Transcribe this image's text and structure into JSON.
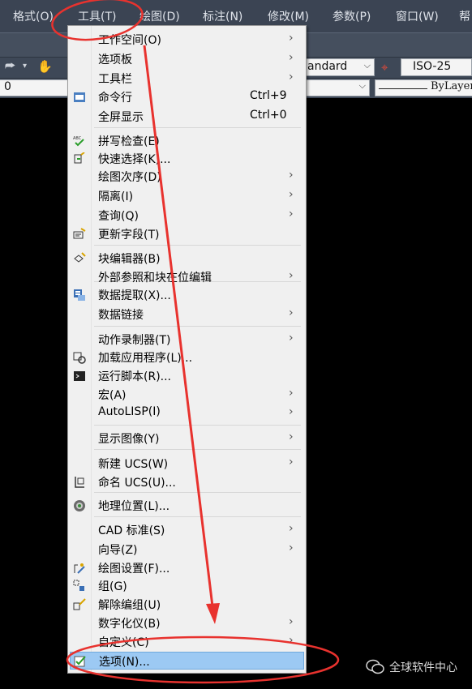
{
  "menubar": {
    "items": [
      "格式(O)",
      "工具(T)",
      "绘图(D)",
      "标注(N)",
      "修改(M)",
      "参数(P)",
      "窗口(W)",
      "帮"
    ]
  },
  "toolbar": {
    "text_style": "andard",
    "dim_style": "ISO-25",
    "layer_value": "0",
    "linetype": "ByLayer"
  },
  "menu": {
    "items": [
      {
        "label": "工作空间(O)",
        "submenu": true
      },
      {
        "label": "选项板",
        "submenu": true
      },
      {
        "label": "工具栏",
        "submenu": true
      },
      {
        "label": "命令行",
        "shortcut": "Ctrl+9",
        "icon": "command-line-icon"
      },
      {
        "label": "全屏显示",
        "shortcut": "Ctrl+0"
      },
      {
        "label": "拼写检查(E)",
        "icon": "spell-check-icon"
      },
      {
        "label": "快速选择(K)...",
        "icon": "quick-select-icon"
      },
      {
        "label": "绘图次序(D)",
        "submenu": true
      },
      {
        "label": "隔离(I)",
        "submenu": true
      },
      {
        "label": "查询(Q)",
        "submenu": true
      },
      {
        "label": "更新字段(T)",
        "icon": "update-field-icon"
      },
      {
        "label": "块编辑器(B)",
        "icon": "block-editor-icon"
      },
      {
        "label": "外部参照和块在位编辑",
        "submenu": true
      },
      {
        "label": "数据提取(X)...",
        "icon": "data-extract-icon"
      },
      {
        "label": "数据链接",
        "submenu": true
      },
      {
        "label": "动作录制器(T)",
        "submenu": true
      },
      {
        "label": "加载应用程序(L)...",
        "icon": "load-app-icon"
      },
      {
        "label": "运行脚本(R)...",
        "icon": "run-script-icon"
      },
      {
        "label": "宏(A)",
        "submenu": true
      },
      {
        "label": "AutoLISP(I)",
        "submenu": true
      },
      {
        "label": "显示图像(Y)",
        "submenu": true
      },
      {
        "label": "新建 UCS(W)",
        "submenu": true
      },
      {
        "label": "命名 UCS(U)...",
        "icon": "named-ucs-icon"
      },
      {
        "label": "地理位置(L)...",
        "icon": "geo-location-icon"
      },
      {
        "label": "CAD 标准(S)",
        "submenu": true
      },
      {
        "label": "向导(Z)",
        "submenu": true
      },
      {
        "label": "绘图设置(F)...",
        "icon": "drafting-settings-icon"
      },
      {
        "label": "组(G)",
        "icon": "group-icon"
      },
      {
        "label": "解除编组(U)",
        "icon": "ungroup-icon"
      },
      {
        "label": "数字化仪(B)",
        "submenu": true
      },
      {
        "label": "自定义(C)",
        "submenu": true
      },
      {
        "label": "选项(N)...",
        "icon": "options-check-icon",
        "highlighted": true
      }
    ]
  },
  "watermark": {
    "text": "全球软件中心"
  },
  "colors": {
    "menubar_bg": "#3b4453",
    "menu_bg": "#f0f0f0",
    "highlight": "#9cc9f3",
    "annotation_red": "#e8322e"
  }
}
